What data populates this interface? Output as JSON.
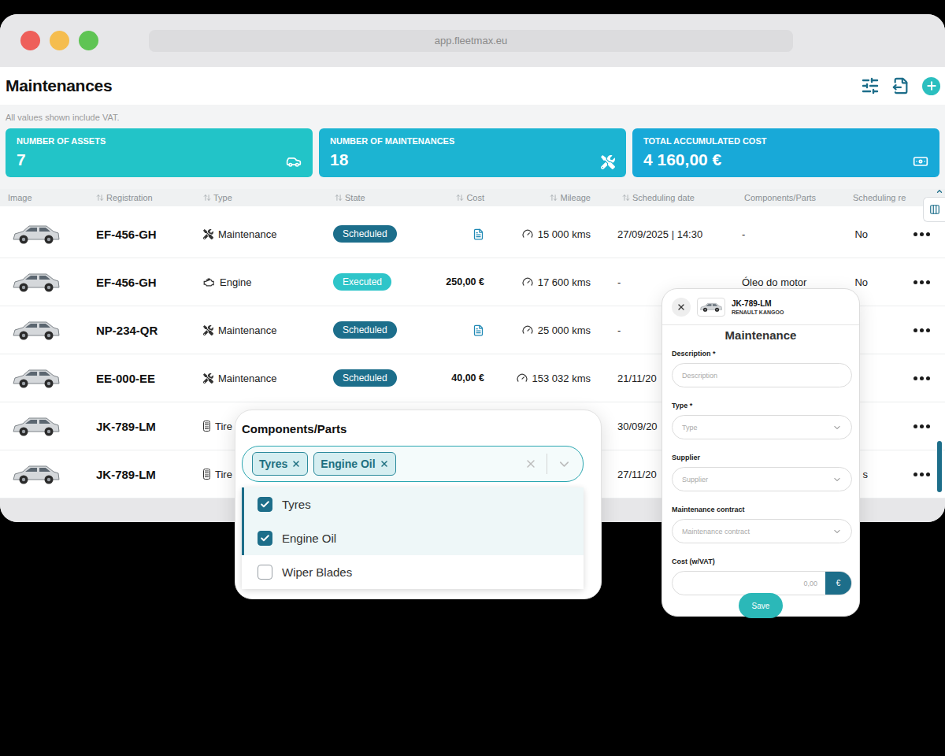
{
  "window": {
    "url": "app.fleetmax.eu"
  },
  "page": {
    "title": "Maintenances",
    "note": "All values shown include VAT."
  },
  "stats": [
    {
      "label": "NUMBER OF ASSETS",
      "value": "7",
      "kind": "assets",
      "color": "#22c4c8"
    },
    {
      "label": "NUMBER OF MAINTENANCES",
      "value": "18",
      "kind": "maintenances",
      "color": "#1cb4d2"
    },
    {
      "label": "TOTAL ACCUMULATED COST",
      "value": "4 160,00 €",
      "kind": "cost",
      "color": "#18a9d8"
    }
  ],
  "table": {
    "columns": [
      {
        "label": "Image",
        "sortable": false
      },
      {
        "label": "Registration",
        "sortable": true
      },
      {
        "label": "Type",
        "sortable": true
      },
      {
        "label": "State",
        "sortable": true
      },
      {
        "label": "Cost",
        "sortable": true
      },
      {
        "label": "Mileage",
        "sortable": true
      },
      {
        "label": "Scheduling date",
        "sortable": true
      },
      {
        "label": "Components/Parts",
        "sortable": false
      },
      {
        "label": "Scheduling re",
        "sortable": true
      }
    ],
    "rows": [
      {
        "registration": "EF-456-GH",
        "type": {
          "label": "Maintenance",
          "kind": "maintenance"
        },
        "state": {
          "label": "Scheduled",
          "color": "#1c6e8b"
        },
        "cost": {
          "kind": "document"
        },
        "mileage": "15 000 kms",
        "date": "27/09/2025 | 14:30",
        "components": "-",
        "reminder": "No"
      },
      {
        "registration": "EF-456-GH",
        "type": {
          "label": "Engine",
          "kind": "engine"
        },
        "state": {
          "label": "Executed",
          "color": "#2ec5c9"
        },
        "cost": {
          "kind": "amount",
          "text": "250,00 €"
        },
        "mileage": "17 600 kms",
        "date": "-",
        "components": "Óleo do motor",
        "reminder": "No"
      },
      {
        "registration": "NP-234-QR",
        "type": {
          "label": "Maintenance",
          "kind": "maintenance"
        },
        "state": {
          "label": "Scheduled",
          "color": "#1c6e8b"
        },
        "cost": {
          "kind": "document"
        },
        "mileage": "25 000 kms",
        "date": "-",
        "components": null,
        "reminder": null
      },
      {
        "registration": "EE-000-EE",
        "type": {
          "label": "Maintenance",
          "kind": "maintenance"
        },
        "state": {
          "label": "Scheduled",
          "color": "#1c6e8b"
        },
        "cost": {
          "kind": "amount",
          "text": "40,00 €"
        },
        "mileage": "153 032 kms",
        "date": "21/11/20",
        "components": null,
        "reminder": null
      },
      {
        "registration": "JK-789-LM",
        "type": {
          "label": "Tire",
          "kind": "tire"
        },
        "state": null,
        "cost": null,
        "mileage": null,
        "date": "30/09/20",
        "components": null,
        "reminder": null
      },
      {
        "registration": "JK-789-LM",
        "type": {
          "label": "Tire",
          "kind": "tire"
        },
        "state": null,
        "cost": null,
        "mileage": null,
        "date": "27/11/20",
        "components": null,
        "reminder": "s"
      }
    ]
  },
  "components_panel": {
    "title": "Components/Parts",
    "chips": [
      "Tyres",
      "Engine Oil"
    ],
    "options": [
      {
        "label": "Tyres",
        "checked": true
      },
      {
        "label": "Engine Oil",
        "checked": true
      },
      {
        "label": "Wiper Blades",
        "checked": false
      }
    ]
  },
  "form": {
    "registration": "JK-789-LM",
    "model": "RENAULT KANGOO",
    "title": "Maintenance",
    "fields": [
      {
        "label": "Description *",
        "placeholder": "Description",
        "kind": "text"
      },
      {
        "label": "Type *",
        "placeholder": "Type",
        "kind": "select"
      },
      {
        "label": "Supplier",
        "placeholder": "Supplier",
        "kind": "select"
      },
      {
        "label": "Maintenance contract",
        "placeholder": "Maintenance contract",
        "kind": "select"
      },
      {
        "label": "Cost (w/VAT)",
        "placeholder": "0,00",
        "kind": "money",
        "addon": "€"
      }
    ],
    "save": "Save"
  }
}
